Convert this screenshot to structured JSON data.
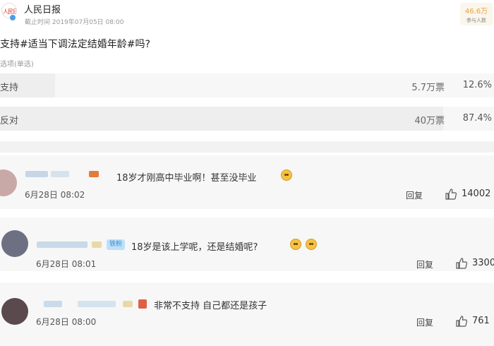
{
  "account": {
    "name": "人民日报",
    "deadline": "截止时间 2019年07月05日 08:00",
    "participants_count": "46.6万",
    "participants_label": "参与人数",
    "logo_text": "人民日报"
  },
  "poll": {
    "question": "支持#适当下调法定结婚年龄#吗?",
    "hint": "选项(单选)",
    "options": [
      {
        "label": "支持",
        "votes": "5.7万票",
        "percent": "12.6%",
        "fraction": 0.126
      },
      {
        "label": "反对",
        "votes": "40万票",
        "percent": "87.4%",
        "fraction": 0.874
      }
    ]
  },
  "comments": [
    {
      "text": "18岁才刚高中毕业啊！甚至没毕业",
      "date": "6月28日 08:02",
      "reply": "回复",
      "likes": "14002"
    },
    {
      "badge": "铁粉",
      "text": "18岁是该上学呢，还是结婚呢?",
      "date": "6月28日 08:01",
      "reply": "回复",
      "likes": "3300"
    },
    {
      "text": "非常不支持 自己都还是孩子",
      "date": "6月28日 08:00",
      "reply": "回复",
      "likes": "761"
    }
  ],
  "colors": {
    "accent": "#e7a33e",
    "verified": "#4a9de8",
    "badge": "#bde0f7"
  }
}
